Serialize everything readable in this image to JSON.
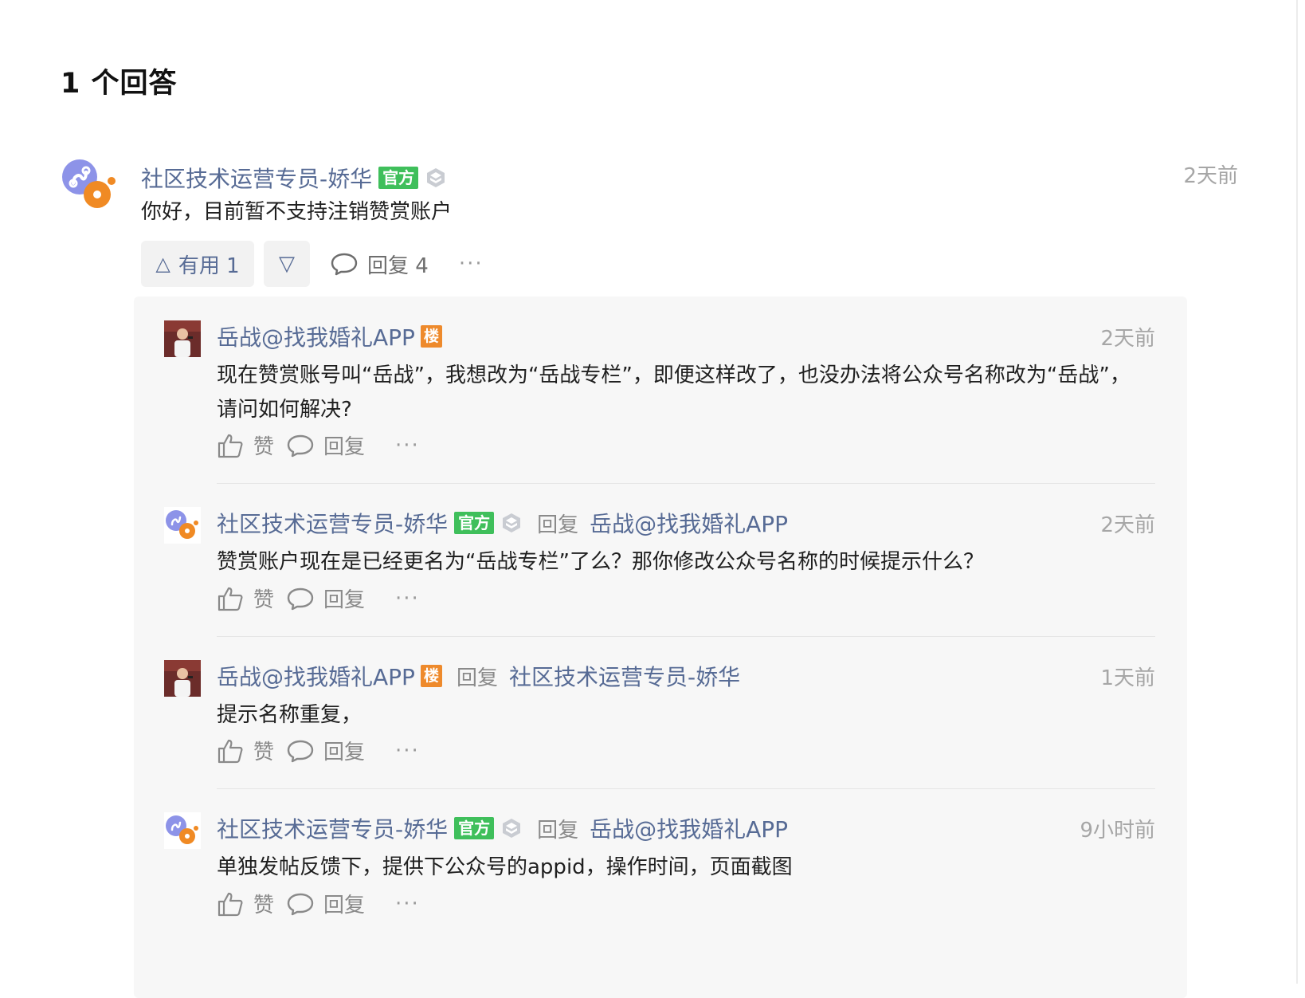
{
  "heading": "1 个回答",
  "answer": {
    "author": "社区技术运营专员-娇华",
    "badge": "官方",
    "time": "2天前",
    "content": "你好，目前暂不支持注销赞赏账户",
    "useful_label": "有用 1",
    "reply_label": "回复 4",
    "more": "···"
  },
  "replies": [
    {
      "author": "岳战@找我婚礼APP",
      "badge": "楼",
      "time": "2天前",
      "content": "现在赞赏账号叫“岳战”，我想改为“岳战专栏”，即便这样改了，也没办法将公众号名称改为“岳战”，请问如何解决?",
      "like_label": "赞",
      "reply_label": "回复",
      "more": "···"
    },
    {
      "author": "社区技术运营专员-娇华",
      "badge": "官方",
      "reply_word": "回复",
      "reply_to": "岳战@找我婚礼APP",
      "time": "2天前",
      "content": "赞赏账户现在是已经更名为“岳战专栏”了么？那你修改公众号名称的时候提示什么？",
      "like_label": "赞",
      "reply_label": "回复",
      "more": "···"
    },
    {
      "author": "岳战@找我婚礼APP",
      "badge": "楼",
      "reply_word": "回复",
      "reply_to": "社区技术运营专员-娇华",
      "time": "1天前",
      "content": "提示名称重复，",
      "like_label": "赞",
      "reply_label": "回复",
      "more": "···"
    },
    {
      "author": "社区技术运营专员-娇华",
      "badge": "官方",
      "reply_word": "回复",
      "reply_to": "岳战@找我婚礼APP",
      "time": "9小时前",
      "content": "单独发帖反馈下，提供下公众号的appid，操作时间，页面截图",
      "like_label": "赞",
      "reply_label": "回复",
      "more": "···"
    }
  ],
  "colors": {
    "link": "#576b95",
    "official_badge": "#3fbf5b",
    "floor_badge": "#ee8a2c",
    "muted": "#a6a6a6",
    "panel_bg": "#f7f7f7"
  },
  "icons": [
    "miniprogram-logo-icon",
    "level-shield-icon",
    "triangle-up-icon",
    "triangle-down-icon",
    "comment-bubble-icon",
    "thumbs-up-icon",
    "user-photo-avatar"
  ]
}
